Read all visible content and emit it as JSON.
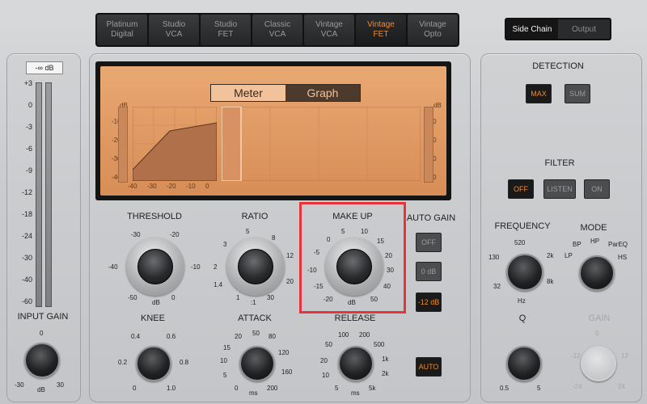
{
  "models": [
    {
      "label": "Platinum\nDigital",
      "active": false
    },
    {
      "label": "Studio\nVCA",
      "active": false
    },
    {
      "label": "Studio\nFET",
      "active": false
    },
    {
      "label": "Classic\nVCA",
      "active": false
    },
    {
      "label": "Vintage\nVCA",
      "active": false
    },
    {
      "label": "Vintage\nFET",
      "active": true
    },
    {
      "label": "Vintage\nOpto",
      "active": false
    }
  ],
  "sidechain": {
    "sidechain_label": "Side Chain",
    "output_label": "Output"
  },
  "left": {
    "readout": "-∞ dB",
    "scale": [
      "+3",
      "0",
      "-3",
      "-6",
      "-9",
      "-12",
      "-18",
      "-24",
      "-30",
      "-40",
      "-60"
    ],
    "input_gain_label": "INPUT GAIN",
    "input_gain_ticks": {
      "top": "0",
      "left": "-30",
      "unit": "dB",
      "right": "30"
    }
  },
  "display": {
    "meter_tab": "Meter",
    "graph_tab": "Graph",
    "db_label": "dB",
    "y_ticks": [
      "-10",
      "-20",
      "-30",
      "-40"
    ],
    "x_ticks": [
      "-40",
      "-30",
      "-20",
      "-10",
      "0"
    ]
  },
  "threshold": {
    "label": "THRESHOLD",
    "ticks": [
      "-30",
      "-20",
      "-40",
      "-10",
      "-50",
      "dB",
      "0"
    ]
  },
  "ratio": {
    "label": "RATIO",
    "ticks": [
      "5",
      "8",
      "3",
      "12",
      "2",
      "20",
      "1.4",
      "1",
      "30",
      ":1"
    ]
  },
  "makeup": {
    "label": "MAKE UP",
    "ticks": [
      "0",
      "5",
      "10",
      "-5",
      "15",
      "-10",
      "20",
      "-15",
      "30",
      "-20",
      "dB",
      "40",
      "50"
    ]
  },
  "autogain": {
    "label": "AUTO GAIN",
    "off": "OFF",
    "zero": "0 dB",
    "minus12": "-12 dB"
  },
  "knee": {
    "label": "KNEE",
    "ticks": [
      "0.4",
      "0.6",
      "0.2",
      "0.8",
      "0",
      "1.0"
    ]
  },
  "attack": {
    "label": "ATTACK",
    "ticks": [
      "20",
      "50",
      "80",
      "15",
      "120",
      "10",
      "160",
      "5",
      "200",
      "0",
      "ms"
    ]
  },
  "release": {
    "label": "RELEASE",
    "ticks": [
      "100",
      "200",
      "50",
      "500",
      "20",
      "1k",
      "10",
      "2k",
      "5",
      "5k",
      "ms"
    ]
  },
  "auto_label": "AUTO",
  "detection": {
    "label": "DETECTION",
    "max": "MAX",
    "sum": "SUM"
  },
  "filter": {
    "label": "FILTER",
    "off": "OFF",
    "listen": "LISTEN",
    "on": "ON"
  },
  "frequency": {
    "label": "FREQUENCY",
    "ticks": [
      "520",
      "130",
      "2k",
      "32",
      "8k",
      "Hz"
    ]
  },
  "mode": {
    "label": "MODE",
    "ticks": [
      "BP",
      "HP",
      "ParEQ",
      "LP",
      "HS"
    ]
  },
  "q": {
    "label": "Q",
    "ticks": [
      "0.5",
      "5"
    ]
  },
  "gain": {
    "label": "GAIN",
    "ticks": [
      "0",
      "-12",
      "12",
      "-24",
      "24"
    ]
  },
  "colors": {
    "accent": "#f08a2c",
    "highlight": "#e8323c",
    "screen": "#e3a06a"
  }
}
